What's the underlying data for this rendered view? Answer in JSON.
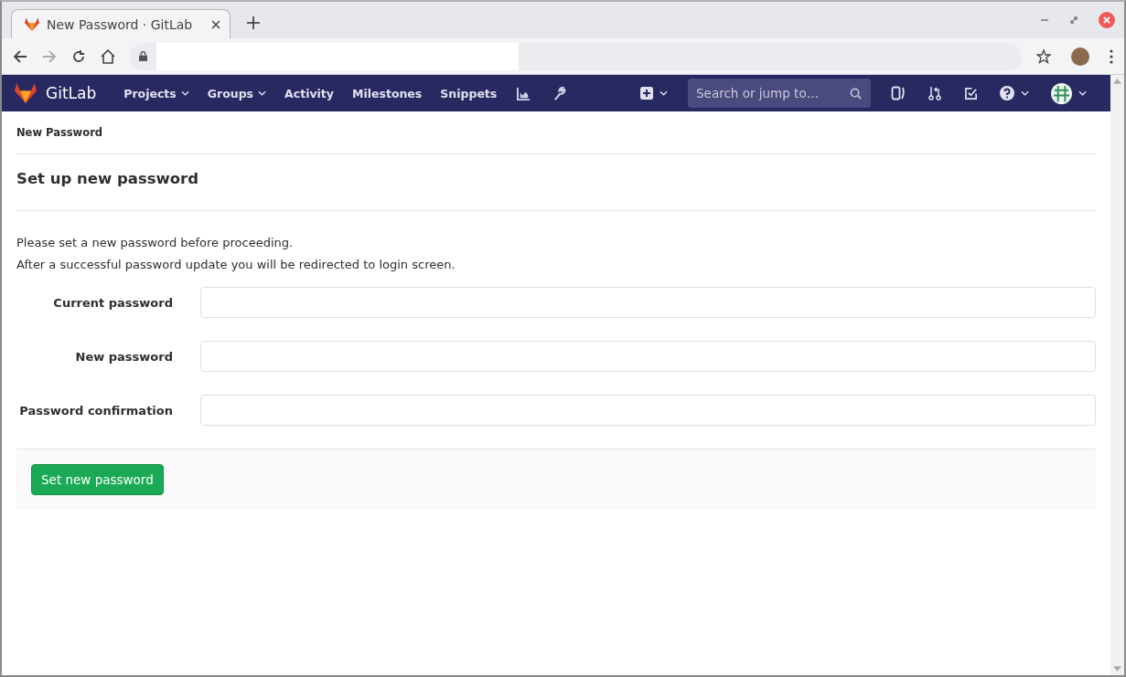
{
  "browser": {
    "tab": {
      "title": "New Password · GitLab",
      "selected": true
    }
  },
  "nav": {
    "brand": "GitLab",
    "items": [
      {
        "label": "Projects",
        "dropdown": true
      },
      {
        "label": "Groups",
        "dropdown": true
      },
      {
        "label": "Activity",
        "dropdown": false
      },
      {
        "label": "Milestones",
        "dropdown": false
      },
      {
        "label": "Snippets",
        "dropdown": false
      }
    ],
    "search": {
      "placeholder": "Search or jump to…"
    }
  },
  "breadcrumb": "New Password",
  "heading": "Set up new password",
  "intro": [
    "Please set a new password before proceeding.",
    "After a successful password update you will be redirected to login screen."
  ],
  "fields": [
    {
      "label": "Current password"
    },
    {
      "label": "New password"
    },
    {
      "label": "Password confirmation"
    }
  ],
  "submit": "Set new password"
}
